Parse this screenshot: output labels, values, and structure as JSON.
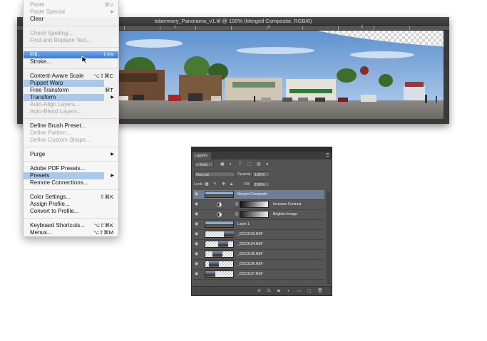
{
  "document": {
    "title": "tobermory_Panorama_v1.tif @ 100% (Merged Composite, RGB/8)",
    "ruler_marks": [
      "1",
      "2",
      "3"
    ]
  },
  "edit_menu": {
    "items": [
      {
        "label": "Paste",
        "shortcut": "⌘V",
        "disabled": true
      },
      {
        "label": "Paste Special",
        "shortcut": "",
        "submenu": true,
        "disabled": true
      },
      {
        "label": "Clear",
        "shortcut": ""
      },
      {
        "label": "Check Spelling...",
        "shortcut": "",
        "disabled": true
      },
      {
        "label": "Find and Replace Text...",
        "shortcut": "",
        "disabled": true
      },
      {
        "label": "Fill...",
        "shortcut": "⇧F5",
        "highlighted": true
      },
      {
        "label": "Stroke...",
        "shortcut": ""
      },
      {
        "label": "Content-Aware Scale",
        "shortcut": "⌥⇧⌘C"
      },
      {
        "label": "Puppet Warp",
        "shortcut": "",
        "selected": true
      },
      {
        "label": "Free Transform",
        "shortcut": "⌘T"
      },
      {
        "label": "Transform",
        "shortcut": "",
        "submenu": true,
        "selected": true
      },
      {
        "label": "Auto-Align Layers...",
        "shortcut": "",
        "disabled": true
      },
      {
        "label": "Auto-Blend Layers...",
        "shortcut": "",
        "disabled": true
      },
      {
        "label": "Define Brush Preset...",
        "shortcut": ""
      },
      {
        "label": "Define Pattern...",
        "shortcut": "",
        "disabled": true
      },
      {
        "label": "Define Custom Shape...",
        "shortcut": "",
        "disabled": true
      },
      {
        "label": "Purge",
        "shortcut": "",
        "submenu": true
      },
      {
        "label": "Adobe PDF Presets...",
        "shortcut": ""
      },
      {
        "label": "Presets",
        "shortcut": "",
        "submenu": true,
        "selected": true
      },
      {
        "label": "Remote Connections...",
        "shortcut": ""
      },
      {
        "label": "Color Settings...",
        "shortcut": "⇧⌘K"
      },
      {
        "label": "Assign Profile...",
        "shortcut": ""
      },
      {
        "label": "Convert to Profile...",
        "shortcut": ""
      },
      {
        "label": "Keyboard Shortcuts...",
        "shortcut": "⌥⇧⌘K"
      },
      {
        "label": "Menus...",
        "shortcut": "⌥⇧⌘M"
      }
    ]
  },
  "layers_panel": {
    "tab_label": "Layers",
    "kind_filter": "Kind",
    "blend_mode": "Normal",
    "opacity_label": "Opacity:",
    "opacity_value": "100%",
    "lock_label": "Lock:",
    "fill_label": "Fill:",
    "fill_value": "100%",
    "layers": [
      {
        "name": "Merged Composite"
      },
      {
        "name": "Increase Contrast"
      },
      {
        "name": "Brighten Image"
      },
      {
        "name": "Layer 1"
      },
      {
        "name": "_DSC3193.NEF"
      },
      {
        "name": "_DSC3194.NEF"
      },
      {
        "name": "_DSC3195.NEF"
      },
      {
        "name": "_DSC3196.NEF"
      },
      {
        "name": "_DSC3197.NEF"
      }
    ]
  },
  "colors": {
    "menu_highlight": "#3a78d9",
    "menu_selected_bar": "#a9c8ea",
    "panel_bg": "#535353",
    "selected_layer": "#6d7f94"
  },
  "icons": [
    "search-icon",
    "eye-icon",
    "link-icon",
    "fx-icon",
    "mask-icon",
    "adjustment-icon",
    "folder-icon",
    "new-layer-icon",
    "trash-icon",
    "panel-menu-icon",
    "mouse-pointer-icon"
  ]
}
